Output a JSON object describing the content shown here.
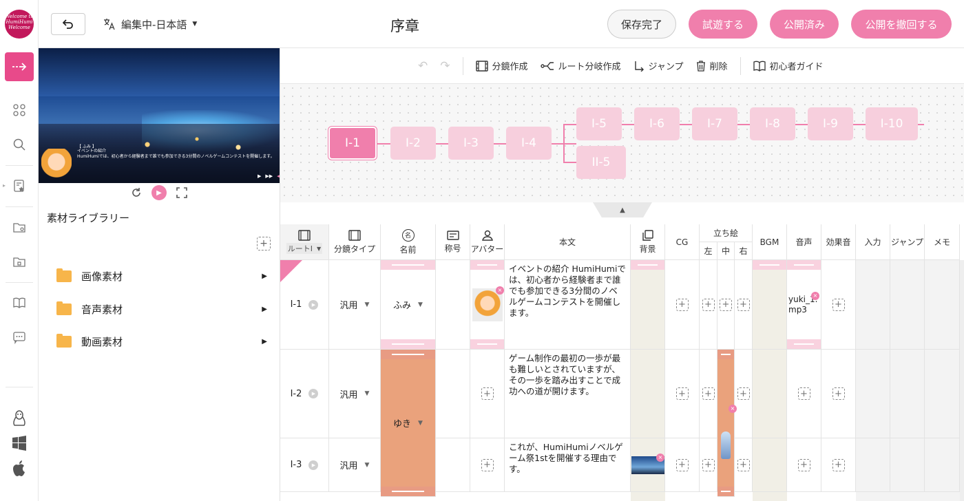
{
  "header": {
    "back_label": "⮌",
    "lang_label": "編集中-日本語",
    "title": "序章",
    "save_label": "保存完了",
    "playtest_label": "試遊する",
    "published_label": "公開済み",
    "unpublish_label": "公開を撤回する"
  },
  "logo_text": "Welcome to HumiHumi Welcome",
  "preview": {
    "speaker": "【 ふみ 】",
    "line1": "イベントの紹介",
    "line2": "HumiHumiでは、初心者から経験者まで誰でも参加できる3分間のノベルゲームコンテストを開催します。"
  },
  "library": {
    "title": "素材ライブラリー",
    "folders": [
      {
        "label": "画像素材"
      },
      {
        "label": "音声素材"
      },
      {
        "label": "動画素材"
      }
    ]
  },
  "toolbar": {
    "storyboard": "分鏡作成",
    "route_branch": "ルート分岐作成",
    "jump": "ジャンプ",
    "delete": "削除",
    "guide": "初心者ガイド"
  },
  "nodes": {
    "main": [
      "I-1",
      "I-2",
      "I-3",
      "I-4"
    ],
    "branch_top": [
      "I-5",
      "I-6",
      "I-7",
      "I-8",
      "I-9",
      "I-10"
    ],
    "branch_bottom": [
      "II-5"
    ]
  },
  "table": {
    "headers": {
      "route": "ルートⅠ",
      "type": "分鏡タイプ",
      "name": "名前",
      "title_col": "称号",
      "avatar": "アバター",
      "body": "本文",
      "bg": "背景",
      "cg": "CG",
      "standing": "立ち絵",
      "left": "左",
      "center": "中",
      "right": "右",
      "bgm": "BGM",
      "voice": "音声",
      "se": "効果音",
      "input": "入力",
      "jump": "ジャンプ",
      "memo": "メモ"
    },
    "rows": [
      {
        "id": "I-1",
        "type": "汎用",
        "name": "ふみ",
        "text": "イベントの紹介 HumiHumiでは、初心者から経験者まで誰でも参加できる3分間のノベルゲームコンテストを開催します。",
        "voice": "yuki_1.mp3"
      },
      {
        "id": "I-2",
        "type": "汎用",
        "name": "ゆき",
        "text": "ゲーム制作の最初の一歩が最も難しいとされていますが、その一歩を踏み出すことで成功への道が開けます。"
      },
      {
        "id": "I-3",
        "type": "汎用",
        "name": "",
        "text": "これが、HumiHumiノベルゲーム祭1stを開催する理由です。"
      }
    ]
  }
}
